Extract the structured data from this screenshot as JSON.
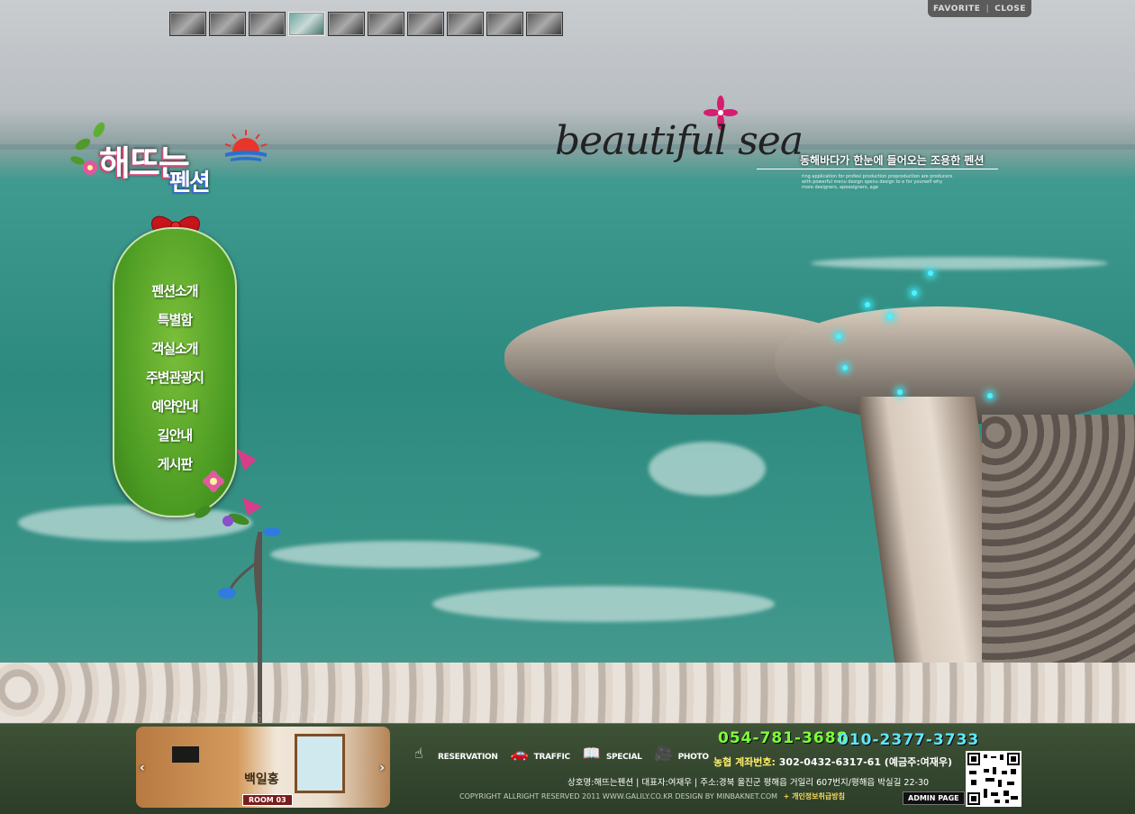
{
  "top_nav": {
    "favorite": "FAVORITE",
    "separator": "|",
    "close": "CLOSE"
  },
  "thumbnails": [
    {
      "label": "photo-1"
    },
    {
      "label": "photo-2"
    },
    {
      "label": "photo-3"
    },
    {
      "label": "photo-4"
    },
    {
      "label": "photo-5"
    },
    {
      "label": "photo-6"
    },
    {
      "label": "photo-7"
    },
    {
      "label": "photo-8"
    },
    {
      "label": "photo-9"
    },
    {
      "label": "photo-10"
    }
  ],
  "logo": {
    "line1": "해뜨는",
    "line2": "펜션"
  },
  "slogan": {
    "script": "beautiful sea",
    "subtitle": "동해바다가 한눈에 들어오는 조용한 펜션",
    "fine_print": "ring application for profesi production proproduction are producers with powerful menu design spenu design to e for yourself why more designers, apeesigners, age"
  },
  "menu": {
    "items": [
      "펜션소개",
      "특별함",
      "객실소개",
      "주변관광지",
      "예약안내",
      "길안내",
      "게시판"
    ]
  },
  "footer": {
    "ghost_text": "ROOM OF GALILY",
    "room": {
      "name": "백일홍",
      "tag": "ROOM 03",
      "prev": "‹",
      "next": "›"
    },
    "quick_links": [
      {
        "label": "RESERVATION",
        "icon": "hand-pointer-icon"
      },
      {
        "label": "TRAFFIC",
        "icon": "car-icon"
      },
      {
        "label": "SPECIAL",
        "icon": "book-icon"
      },
      {
        "label": "PHOTO",
        "icon": "camera-icon"
      }
    ],
    "phone1": "054-781-3688",
    "phone2": "010-2377-3733",
    "bank_label": "농협 계좌번호:",
    "bank_value": " 302-0432-6317-61 (예금주:여재우)",
    "address": "상호명:해뜨는펜션  |  대표자:여재우  |  주소:경북 울진군 평해읍 거일리 607번지/평해읍 박실길 22-30",
    "copyright": "COPYRIGHT ALLRIGHT RESERVED 2011 WWW.GALILY.CO.KR  DESIGN BY MINBAKNET.COM",
    "privacy": "+ 개인정보취급방침",
    "admin": "ADMIN PAGE"
  },
  "colors": {
    "menu_green": "#4a9a22",
    "phone1": "#7cff3a",
    "phone2": "#5ee7ff",
    "footer_bg": "#2c3d28"
  }
}
